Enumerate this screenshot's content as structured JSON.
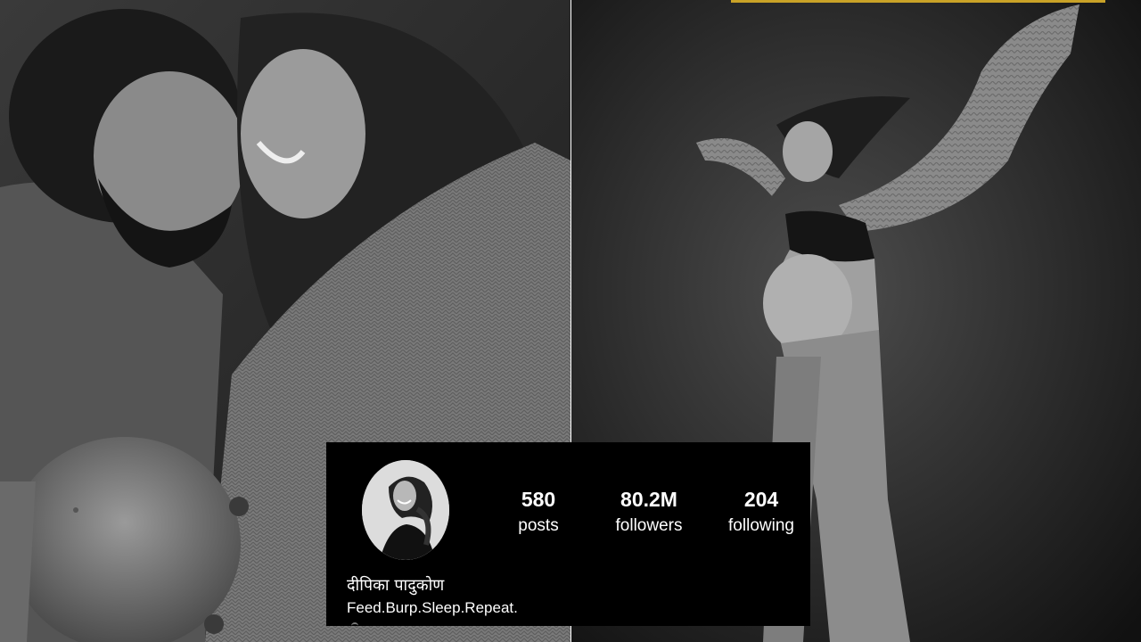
{
  "profile": {
    "name": "दीपिका पादुकोण",
    "bio": "Feed.Burp.Sleep.Repeat.",
    "stats": {
      "posts": {
        "value": "580",
        "label": "posts"
      },
      "followers": {
        "value": "80.2M",
        "label": "followers"
      },
      "following": {
        "value": "204",
        "label": "following"
      }
    }
  },
  "colors": {
    "card_background": "#000000",
    "card_text": "#ffffff",
    "accent": "#c9a227"
  }
}
